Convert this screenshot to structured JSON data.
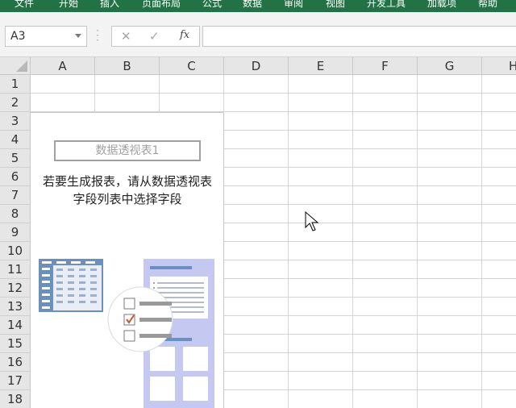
{
  "ribbon": {
    "tabs": [
      "文件",
      "开始",
      "插入",
      "页面布局",
      "公式",
      "数据",
      "审阅",
      "视图",
      "开发工具",
      "加载项",
      "帮助"
    ]
  },
  "formula_bar": {
    "name_box": "A3",
    "formula": ""
  },
  "grid": {
    "columns": [
      "A",
      "B",
      "C",
      "D",
      "E",
      "F",
      "G",
      "H"
    ],
    "rows": [
      "1",
      "2",
      "3",
      "4",
      "5",
      "6",
      "7",
      "8",
      "9",
      "10",
      "11",
      "12",
      "13",
      "14",
      "15",
      "16",
      "17",
      "18"
    ]
  },
  "pivot": {
    "name": "数据透视表1",
    "message_line1": "若要生成报表，请从数据透视表",
    "message_line2": "字段列表中选择字段"
  },
  "colors": {
    "ribbon": "#217346",
    "illustration_blue": "#6a8fc2",
    "illustration_lavender": "#c5c8f0",
    "check_orange": "#c8562b"
  }
}
